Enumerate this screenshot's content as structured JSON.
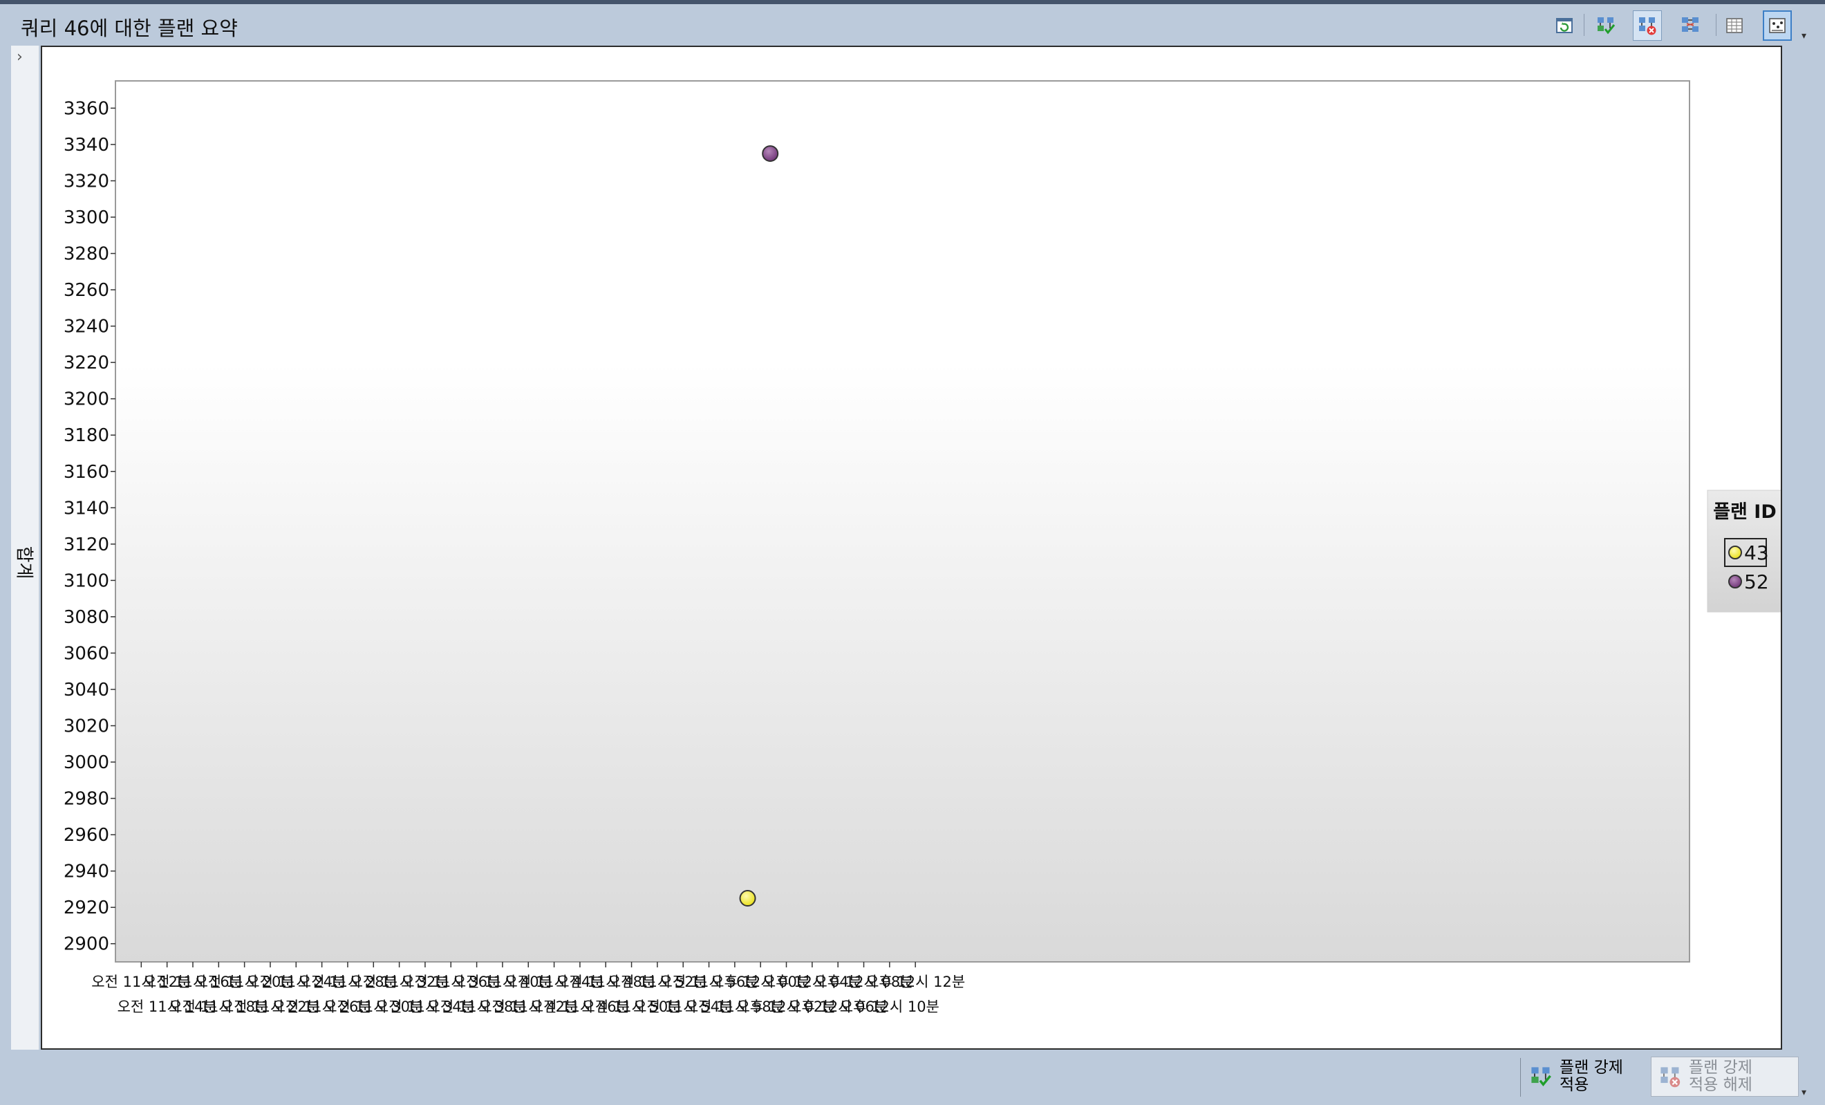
{
  "window": {
    "title": "쿼리 46에 대한 플랜 요약"
  },
  "toolbar": {
    "buttons": [
      {
        "icon": "refresh-icon",
        "state": "normal"
      },
      {
        "icon": "force-plan-icon",
        "state": "normal"
      },
      {
        "icon": "unforce-plan-icon",
        "state": "pressed"
      },
      {
        "icon": "compare-plans-icon",
        "state": "normal"
      },
      {
        "icon": "grid-view-icon",
        "state": "normal"
      },
      {
        "icon": "chart-view-icon",
        "state": "selected"
      }
    ]
  },
  "side_panel": {
    "collapse_glyph": "›",
    "y_axis_label": "합계"
  },
  "chart_data": {
    "type": "scatter",
    "ylabel": "합계",
    "xlabel": "",
    "ylim": [
      2890,
      3375
    ],
    "yticks": [
      2900,
      2920,
      2940,
      2960,
      2980,
      3000,
      3020,
      3040,
      3060,
      3080,
      3100,
      3120,
      3140,
      3160,
      3180,
      3200,
      3220,
      3240,
      3260,
      3280,
      3300,
      3320,
      3340,
      3360
    ],
    "x_domain_minutes": [
      10,
      132
    ],
    "x_ticks_minutes": [
      12,
      14,
      16,
      18,
      20,
      22,
      24,
      26,
      28,
      30,
      32,
      34,
      36,
      38,
      40,
      42,
      44,
      46,
      48,
      50,
      52,
      54,
      56,
      58,
      60,
      62,
      64,
      66,
      68,
      70,
      72
    ],
    "x_tick_labels": [
      "오전 11시 12분",
      "오전 11시 14분",
      "오전 11시 16분",
      "오전 11시 18분",
      "오전 11시 20분",
      "오전 11시 22분",
      "오전 11시 24분",
      "오전 11시 26분",
      "오전 11시 28분",
      "오전 11시 30분",
      "오전 11시 32분",
      "오전 11시 34분",
      "오전 11시 36분",
      "오전 11시 38분",
      "오전 11시 40분",
      "오전 11시 42분",
      "오전 11시 44분",
      "오전 11시 46분",
      "오전 11시 48분",
      "오전 11시 50분",
      "오전 11시 52분",
      "오전 11시 54분",
      "오전 11시 56분",
      "오전 11시 58분",
      "오후 12시 00분",
      "오후 12시 02분",
      "오후 12시 04분",
      "오후 12시 06분",
      "오후 12시 08분",
      "오후 12시 10분",
      "오후 12시 12분"
    ],
    "legend": {
      "title": "플랜 ID",
      "position": "right"
    },
    "series": [
      {
        "name": "43",
        "color": "#f3ee2c",
        "points": [
          {
            "x": "오후 12시 00분",
            "y": 2925
          }
        ]
      },
      {
        "name": "52",
        "color": "#8b4c8f",
        "points": [
          {
            "x": "오후 12시 00분",
            "y": 3335
          }
        ]
      }
    ]
  },
  "footer": {
    "force_plan_label": "플랜 강제 적용",
    "unforce_plan_label": "플랜 강제 적용 해제"
  }
}
